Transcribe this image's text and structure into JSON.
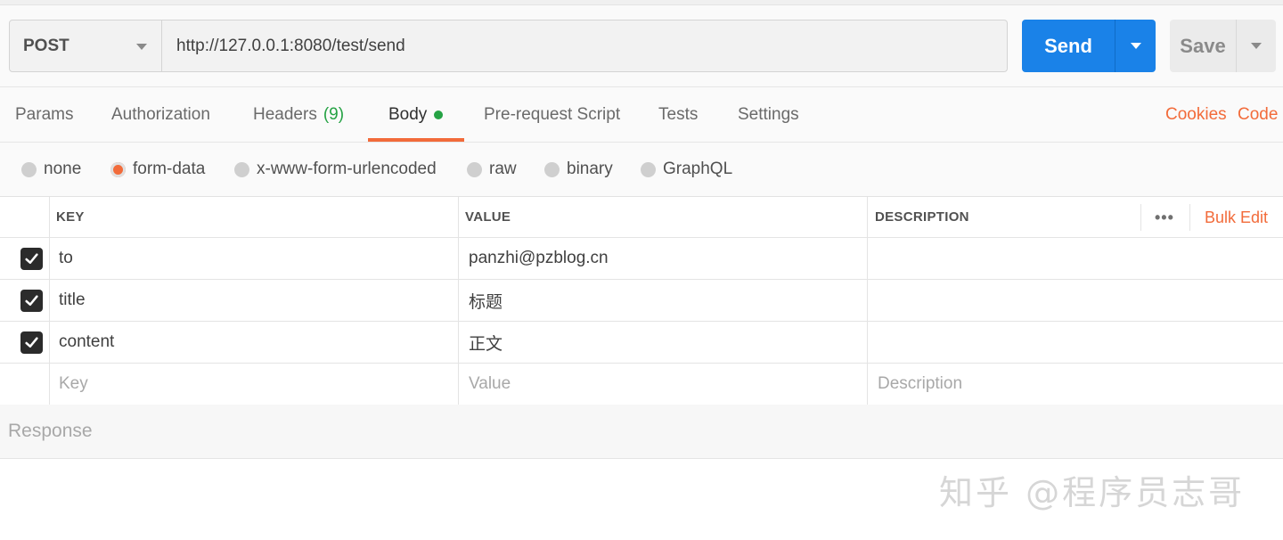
{
  "request": {
    "method": "POST",
    "url": "http://127.0.0.1:8080/test/send",
    "send_label": "Send",
    "save_label": "Save"
  },
  "tabs": [
    {
      "label": "Params"
    },
    {
      "label": "Authorization"
    },
    {
      "label": "Headers",
      "count": "(9)"
    },
    {
      "label": "Body",
      "active": true
    },
    {
      "label": "Pre-request Script"
    },
    {
      "label": "Tests"
    },
    {
      "label": "Settings"
    }
  ],
  "links": {
    "cookies": "Cookies",
    "code": "Code"
  },
  "body_types": [
    {
      "label": "none"
    },
    {
      "label": "form-data",
      "selected": true
    },
    {
      "label": "x-www-form-urlencoded"
    },
    {
      "label": "raw"
    },
    {
      "label": "binary"
    },
    {
      "label": "GraphQL"
    }
  ],
  "table": {
    "headers": {
      "key": "KEY",
      "value": "VALUE",
      "description": "DESCRIPTION"
    },
    "more": "•••",
    "bulk_edit": "Bulk Edit",
    "rows": [
      {
        "key": "to",
        "value": "panzhi@pzblog.cn",
        "checked": true
      },
      {
        "key": "title",
        "value": "标题",
        "checked": true
      },
      {
        "key": "content",
        "value": "正文",
        "checked": true
      }
    ],
    "placeholders": {
      "key": "Key",
      "value": "Value",
      "description": "Description"
    }
  },
  "response_label": "Response",
  "watermark": "知乎 @程序员志哥",
  "colors": {
    "accent": "#f26b3a",
    "primary": "#1a82e8",
    "success": "#25a244"
  }
}
